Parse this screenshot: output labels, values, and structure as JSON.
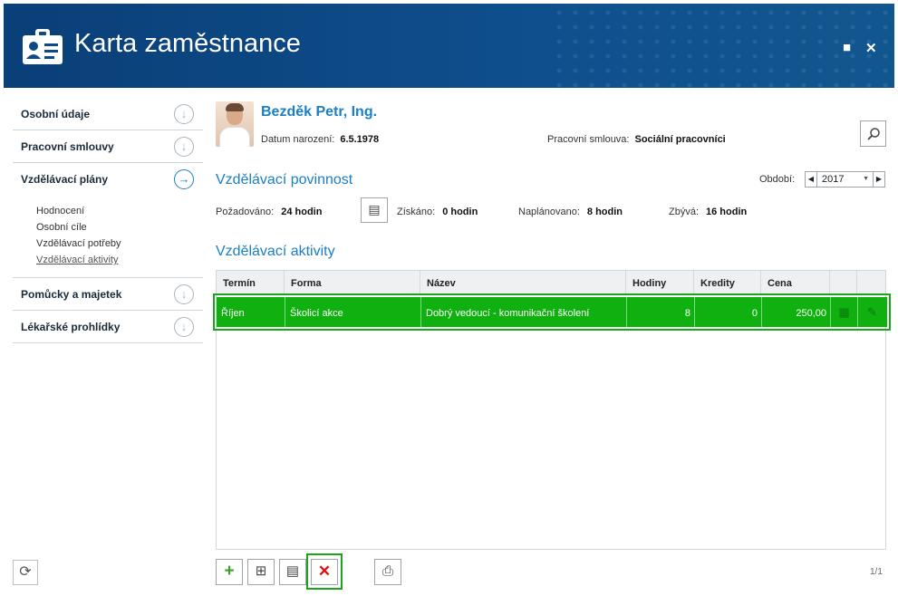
{
  "window": {
    "title": "Karta zaměstnance",
    "maximize_glyph": "■",
    "close_glyph": "✕"
  },
  "nav": {
    "items": [
      {
        "label": "Osobní údaje",
        "icon": "arrow-down-circle-icon",
        "glyph": "↓"
      },
      {
        "label": "Pracovní smlouvy",
        "icon": "arrow-down-circle-icon",
        "glyph": "↓"
      },
      {
        "label": "Vzdělávací plány",
        "icon": "arrow-right-circle-icon",
        "glyph": "→"
      },
      {
        "label": "Pomůcky a majetek",
        "icon": "arrow-down-circle-icon",
        "glyph": "↓"
      },
      {
        "label": "Lékařské prohlídky",
        "icon": "arrow-down-circle-icon",
        "glyph": "↓"
      }
    ],
    "sub_items": [
      "Hodnocení",
      "Osobní cíle",
      "Vzdělávací potřeby",
      "Vzdělávací aktivity"
    ]
  },
  "employee": {
    "name": "Bezděk Petr, Ing.",
    "dob_label": "Datum narození:",
    "dob_value": "6.5.1978",
    "contract_label": "Pracovní smlouva:",
    "contract_value": "Sociální pracovníci"
  },
  "obligation": {
    "title": "Vzdělávací povinnost",
    "period_label": "Období:",
    "period_value": "2017",
    "required_label": "Požadováno:",
    "required_value": "24 hodin",
    "earned_label": "Získáno:",
    "earned_value": "0 hodin",
    "planned_label": "Naplánovano:",
    "planned_value": "8 hodin",
    "remaining_label": "Zbývá:",
    "remaining_value": "16 hodin"
  },
  "activities": {
    "title": "Vzdělávací aktivity",
    "columns": [
      "Termín",
      "Forma",
      "Název",
      "Hodiny",
      "Kredity",
      "Cena",
      "",
      ""
    ],
    "rows": [
      {
        "termin": "Říjen",
        "forma": "Školicí akce",
        "nazev": "Dobrý vedoucí - komunikační školení",
        "hodiny": "8",
        "kredity": "0",
        "cena": "250,00"
      }
    ]
  },
  "pager": "1/1",
  "colors": {
    "header": "#0d4b86",
    "accent": "#1a7fc4",
    "selected_row": "#10b010",
    "highlight_border": "#1aa51a",
    "delete": "#e01010",
    "add": "#3aa02a"
  }
}
